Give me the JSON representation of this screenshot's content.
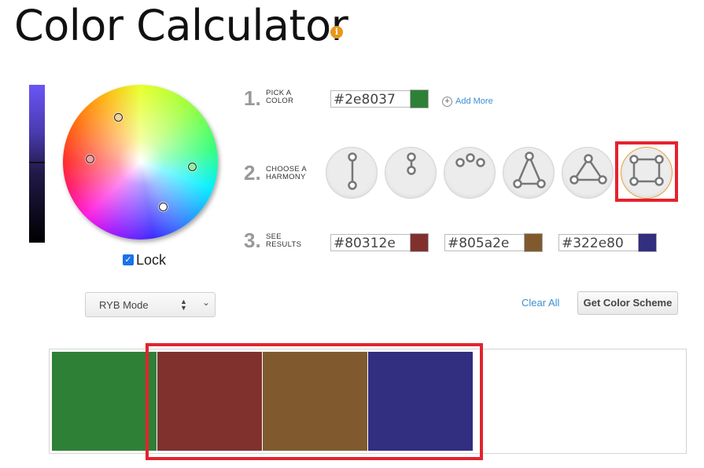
{
  "header": {
    "title": "Color Calculator",
    "info_icon": "info-icon"
  },
  "steps": {
    "pick": {
      "number": "1.",
      "label_line1": "PICK A",
      "label_line2": "COLOR",
      "hex": "#2e8037",
      "color": "#2e8037",
      "add_more": "Add More"
    },
    "harmony": {
      "number": "2.",
      "label_line1": "CHOOSE A",
      "label_line2": "HARMONY",
      "options": [
        "complementary",
        "split-complementary",
        "analogous",
        "triad",
        "triad-alt",
        "square"
      ],
      "selected": "square"
    },
    "results": {
      "number": "3.",
      "label_line1": "SEE",
      "label_line2": "RESULTS",
      "colors": [
        {
          "hex": "#80312e",
          "color": "#80312e"
        },
        {
          "hex": "#805a2e",
          "color": "#805a2e"
        },
        {
          "hex": "#322e80",
          "color": "#322e80"
        }
      ]
    }
  },
  "lock": {
    "label": "Lock",
    "checked": true
  },
  "mode_select": {
    "value": "RYB Mode"
  },
  "buttons": {
    "clear_all": "Clear All",
    "get_scheme": "Get Color Scheme"
  },
  "scheme": {
    "colors": [
      "#2e8037",
      "#80312e",
      "#805a2e",
      "#322e80"
    ]
  },
  "highlight_color": "#e3232e"
}
